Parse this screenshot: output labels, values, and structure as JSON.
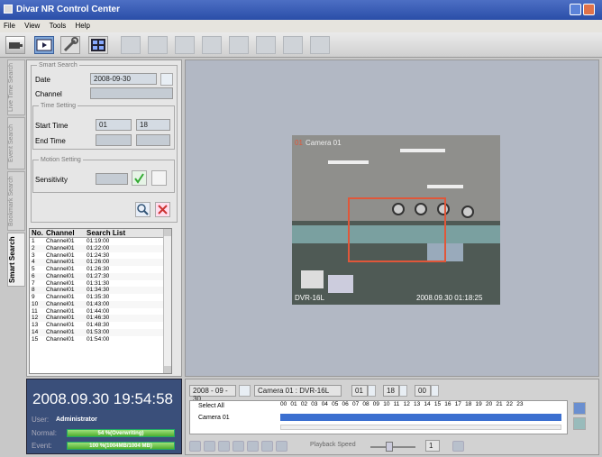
{
  "window": {
    "title": "Divar NR Control Center"
  },
  "menu": {
    "items": [
      "File",
      "View",
      "Tools",
      "Help"
    ]
  },
  "toolbar": {
    "buttons": [
      "live-view-icon",
      "playback-icon",
      "tools-icon",
      "camera-grid-icon"
    ]
  },
  "side_tabs": {
    "items": [
      "Live Time Search",
      "Event Search",
      "Bookmark Search",
      "Smart Search"
    ],
    "active": "Smart Search"
  },
  "smart_search": {
    "group_label": "Smart Search",
    "date_label": "Date",
    "date_value": "2008-09-30",
    "channel_label": "Channel",
    "time_group_label": "Time Setting",
    "start_time_label": "Start Time",
    "start_hour": "01",
    "start_min": "18",
    "end_time_label": "End Time",
    "motion_group_label": "Motion Setting",
    "sensitivity_label": "Sensitivity"
  },
  "results": {
    "columns": [
      "No.",
      "Channel",
      "Search List"
    ],
    "rows": [
      [
        "1",
        "Channel01",
        "01:19:00"
      ],
      [
        "2",
        "Channel01",
        "01:22:00"
      ],
      [
        "3",
        "Channel01",
        "01:24:30"
      ],
      [
        "4",
        "Channel01",
        "01:26:00"
      ],
      [
        "5",
        "Channel01",
        "01:26:30"
      ],
      [
        "6",
        "Channel01",
        "01:27:30"
      ],
      [
        "7",
        "Channel01",
        "01:31:30"
      ],
      [
        "8",
        "Channel01",
        "01:34:30"
      ],
      [
        "9",
        "Channel01",
        "01:35:30"
      ],
      [
        "10",
        "Channel01",
        "01:43:00"
      ],
      [
        "11",
        "Channel01",
        "01:44:00"
      ],
      [
        "12",
        "Channel01",
        "01:46:30"
      ],
      [
        "13",
        "Channel01",
        "01:48:30"
      ],
      [
        "14",
        "Channel01",
        "01:53:00"
      ],
      [
        "15",
        "Channel01",
        "01:54:00"
      ]
    ]
  },
  "status": {
    "datetime": "2008.09.30  19:54:58",
    "user_label": "User:",
    "user_value": "Administrator",
    "normal_label": "Normal:",
    "normal_bar": "54 %(Overwriting)",
    "normal_pct": 100,
    "event_label": "Event:",
    "event_bar": "100 %(1004MB/1004 MB)",
    "event_pct": 100
  },
  "camera": {
    "label_num": "01",
    "label_name": "Camera 01",
    "overlay_name": "DVR-16L",
    "timestamp": "2008.09.30 01:18:25"
  },
  "timeline": {
    "date": "2008 - 09 - 30",
    "camera_select": "Camera 01 : DVR-16L",
    "hour": "01",
    "minute": "18",
    "second": "00",
    "select_all": "Select All",
    "camera_row": "Camera 01",
    "hours": [
      "00",
      "01",
      "02",
      "03",
      "04",
      "05",
      "06",
      "07",
      "08",
      "09",
      "10",
      "11",
      "12",
      "13",
      "14",
      "15",
      "16",
      "17",
      "18",
      "19",
      "20",
      "21",
      "22",
      "23"
    ],
    "playback_speed_label": "Playback Speed",
    "playback_speed_value": "1"
  },
  "colors": {
    "accent": "#2a4ea8",
    "motion_box": "#e0573a",
    "status_bg": "#3a4f7a"
  }
}
